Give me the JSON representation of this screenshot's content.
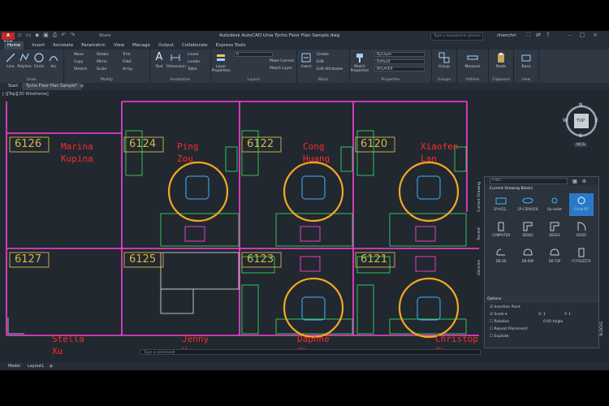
{
  "window": {
    "logo": "A CAD",
    "title": "Autodesk AutoCAD Ursa   Tycho Floor Plan Sample.dwg",
    "share": "Share",
    "search_placeholder": "Type a keyword or phrase",
    "user": "chenchri"
  },
  "ribbon_tabs": [
    "Home",
    "Insert",
    "Annotate",
    "Parametric",
    "View",
    "Manage",
    "Output",
    "Collaborate",
    "Express Tools"
  ],
  "ribbon": {
    "draw": {
      "title": "Draw",
      "tools": [
        "Line",
        "Polyline",
        "Circle",
        "Arc"
      ]
    },
    "modify": {
      "title": "Modify",
      "tools": [
        "Move",
        "Copy",
        "Scale",
        "Rotate",
        "Mirror",
        "Stretch",
        "Trim",
        "Fillet",
        "Array"
      ]
    },
    "annotation": {
      "title": "Annotation",
      "tools": [
        "Text",
        "Dimension",
        "Linear",
        "Leader",
        "Table"
      ]
    },
    "layers": {
      "title": "Layers",
      "tools": [
        "Layer Properties",
        "Make Current",
        "Match Layer"
      ],
      "current_layer": "0"
    },
    "block": {
      "title": "Block",
      "tools": [
        "Insert",
        "Create",
        "Edit",
        "Edit Attributes"
      ]
    },
    "properties": {
      "title": "Properties",
      "tools": [
        "Match Properties"
      ],
      "color": "ByLayer",
      "lineweight": "Default",
      "linetype": "BYLAYER"
    },
    "groups": {
      "title": "Groups",
      "tools": [
        "Group"
      ]
    },
    "utilities": {
      "title": "Utilities",
      "tools": [
        "Measure"
      ]
    },
    "clipboard": {
      "title": "Clipboard",
      "tools": [
        "Paste"
      ]
    },
    "view": {
      "title": "View",
      "tools": [
        "Base"
      ]
    }
  },
  "doc_tabs": [
    "Start",
    "Tycho Floor Plan Sample*"
  ],
  "viewport_label": "[-][Top][2D Wireframe]",
  "viewcube": {
    "face": "TOP",
    "north": "N",
    "south": "S",
    "east": "E",
    "west": "W",
    "wcs": "WCS"
  },
  "rooms": [
    {
      "number": "6126",
      "occupant_line1": "Marina",
      "occupant_line2": "Kupina"
    },
    {
      "number": "6124",
      "occupant_line1": "Ping",
      "occupant_line2": "Zou"
    },
    {
      "number": "6122",
      "occupant_line1": "Cong",
      "occupant_line2": "Huang"
    },
    {
      "number": "6120",
      "occupant_line1": "Xiaofen",
      "occupant_line2": "Lan"
    },
    {
      "number": "6127",
      "occupant_line1": "Stella",
      "occupant_line2": "Xu"
    },
    {
      "number": "6125",
      "occupant_line1": "Jenny",
      "occupant_line2": "Yu"
    },
    {
      "number": "6123",
      "occupant_line1": "Daphne",
      "occupant_line2": "Chen"
    },
    {
      "number": "6121",
      "occupant_line1": "Christop",
      "occupant_line2": "Chen"
    }
  ],
  "command_line": {
    "placeholder": "Type a command"
  },
  "layout_tabs": [
    "Model",
    "Layout1"
  ],
  "palette": {
    "filter_placeholder": "Filter...",
    "section": "Current Drawing Blocks",
    "blocks": [
      "1P-ACQ...",
      "1P-CSRAU18",
      "6p-cadet",
      "Circle R7",
      "COMPUTER",
      "DESK2",
      "DESK3",
      "DOOR",
      "DR-36",
      "DR-69P",
      "DR-72P",
      "FCY5XZZ7A"
    ],
    "side_tabs": [
      "Current Drawing",
      "Recent",
      "Libraries"
    ],
    "blocks_label": "BLOCKS",
    "options": {
      "title": "Options",
      "insertion_point": "Insertion Point",
      "scale": "Scale",
      "x_label": "X:",
      "x_value": "1",
      "y_label": "Y:",
      "y_value": "1",
      "rotation": "Rotation",
      "rotation_value": "0.00",
      "angle": "Angle",
      "repeat": "Repeat Placement",
      "explode": "Explode"
    }
  },
  "colors": {
    "wall": "#ff3fd9",
    "text": "#ff2a2a",
    "furniture": "#35d35a",
    "chair": "#3fb5ff",
    "highlight": "#f5a623",
    "label_box": "#d4b84a"
  }
}
